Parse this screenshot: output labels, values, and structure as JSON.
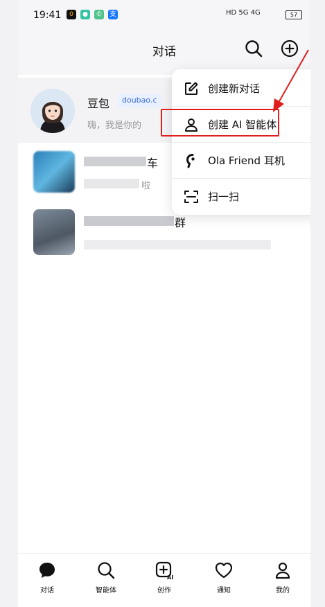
{
  "status_bar": {
    "time": "19:41",
    "app_icons": [
      "notification-app-icon",
      "message-icon",
      "phone-icon",
      "alipay-icon"
    ],
    "right_text": "HD 5G 4G",
    "battery": "57"
  },
  "header": {
    "title": "对话",
    "search_icon": "search-icon",
    "add_icon": "plus-circle-icon"
  },
  "chats": [
    {
      "name": "豆包",
      "tag": "doubao.c",
      "preview": "嗨，我是你的"
    },
    {
      "name": "车",
      "preview": "啦"
    },
    {
      "name": "群",
      "preview": ""
    }
  ],
  "menu": {
    "items": [
      {
        "label": "创建新对话",
        "icon": "edit-icon"
      },
      {
        "label": "创建 AI 智能体",
        "icon": "person-icon"
      },
      {
        "label": "Ola Friend 耳机",
        "icon": "earphone-icon"
      },
      {
        "label": "扫一扫",
        "icon": "scan-icon"
      }
    ]
  },
  "tabs": [
    {
      "label": "对话",
      "icon": "chat-bubble-icon"
    },
    {
      "label": "智能体",
      "icon": "search-icon"
    },
    {
      "label": "创作",
      "icon": "create-ai-icon"
    },
    {
      "label": "通知",
      "icon": "heart-icon"
    },
    {
      "label": "我的",
      "icon": "profile-icon"
    }
  ],
  "colors": {
    "highlight": "#e11e1e",
    "tag_text": "#3b6fe0",
    "background": "#f6f6f8"
  }
}
